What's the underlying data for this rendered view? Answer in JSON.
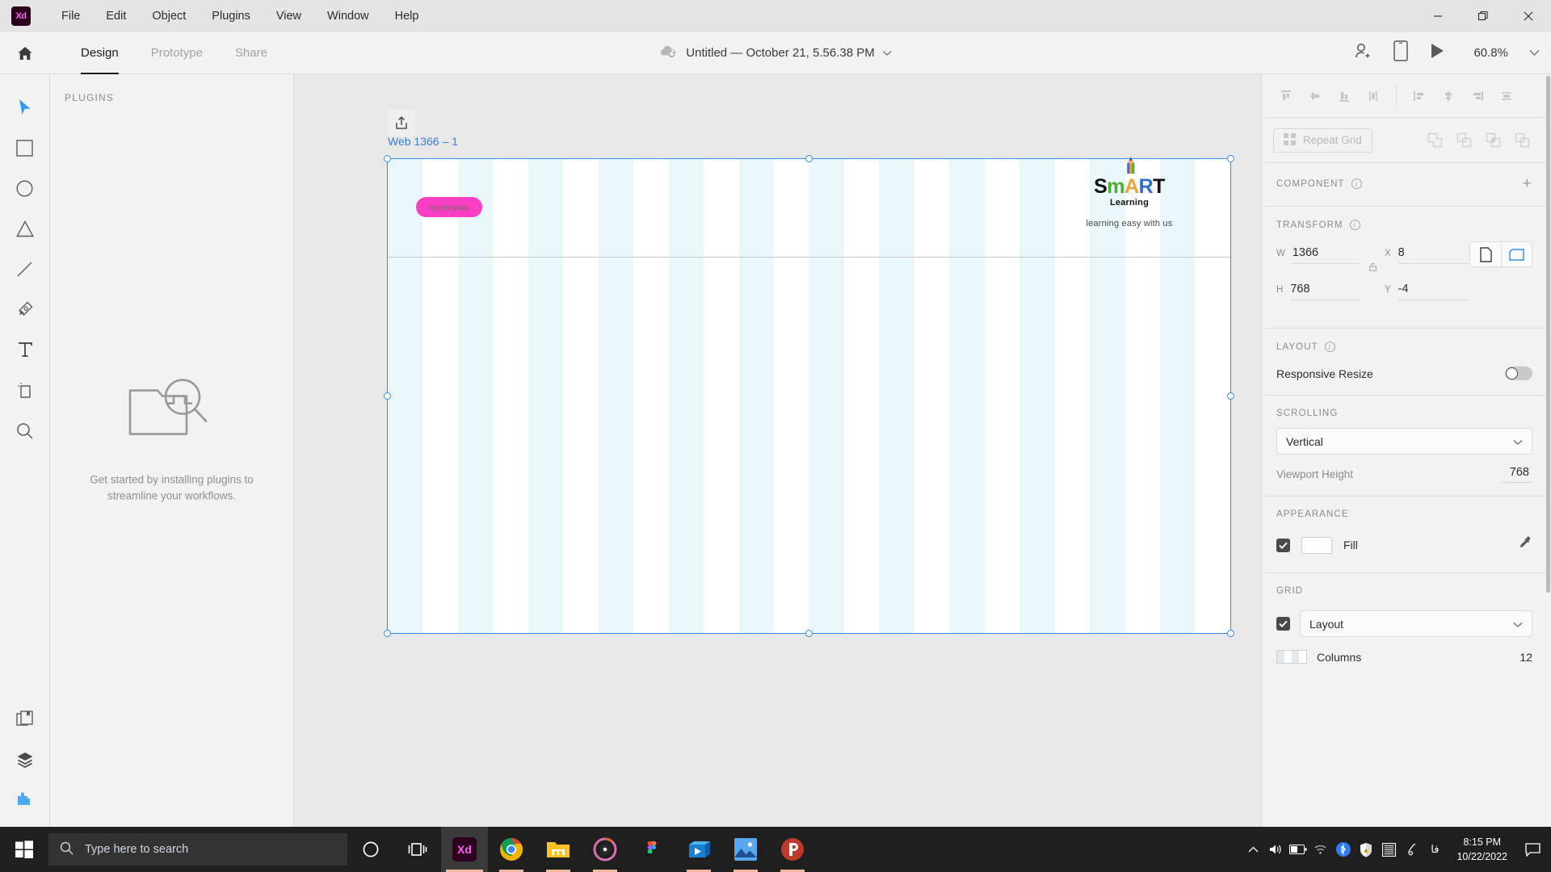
{
  "titlebar": {
    "app_logo": "xd-logo",
    "app_logo_text": "Xd",
    "menus": [
      "File",
      "Edit",
      "Object",
      "Plugins",
      "View",
      "Window",
      "Help"
    ],
    "window_controls": [
      "minimize",
      "maximize",
      "close"
    ]
  },
  "appbar": {
    "home_icon": "home-icon",
    "tabs": [
      {
        "label": "Design",
        "active": true
      },
      {
        "label": "Prototype",
        "active": false
      },
      {
        "label": "Share",
        "active": false
      }
    ],
    "cloud_icon": "cloud-sync-icon",
    "doc_title": "Untitled — October 21, 5.56.38 PM",
    "doc_title_caret": "chevron-down-icon",
    "invite_icon": "invite-user-icon",
    "device_preview_icon": "mobile-device-icon",
    "play_icon": "play-desktop-preview-icon",
    "zoom_level": "60.8%",
    "zoom_caret": "chevron-down-icon"
  },
  "toolbar": {
    "tools": [
      {
        "name": "select-tool",
        "active": true
      },
      {
        "name": "rectangle-tool",
        "active": false
      },
      {
        "name": "ellipse-tool",
        "active": false
      },
      {
        "name": "polygon-tool",
        "active": false
      },
      {
        "name": "line-tool",
        "active": false
      },
      {
        "name": "pen-tool",
        "active": false
      },
      {
        "name": "text-tool",
        "active": false
      },
      {
        "name": "artboard-tool",
        "active": false
      },
      {
        "name": "zoom-tool",
        "active": false
      }
    ],
    "panels": [
      {
        "name": "assets-panel-button",
        "active": false
      },
      {
        "name": "layers-panel-button",
        "active": false
      },
      {
        "name": "plugins-panel-button",
        "active": true
      }
    ]
  },
  "plugins_panel": {
    "title": "PLUGINS",
    "empty_icon": "plugins-search-illustration",
    "empty_text": "Get started by installing plugins to streamline your workflows."
  },
  "canvas": {
    "artboard_export_icon": "export-artboard-icon",
    "artboard_name": "Web 1366 – 1",
    "selected": true,
    "artboard_fill": "#ffffff",
    "grid_color": "#e1f3f8",
    "grid_columns": 12,
    "content": {
      "login_button": "login/registar",
      "login_button_color": "#fb3ec4",
      "brand": {
        "letters": [
          {
            "ch": "S",
            "color": "#111111"
          },
          {
            "ch": "m",
            "color": "#4caf2f"
          },
          {
            "ch": "A",
            "color": "#e8a33d"
          },
          {
            "ch": "R",
            "color": "#2f6fd0"
          },
          {
            "ch": "T",
            "color": "#111111"
          }
        ],
        "wordmark": "SmART",
        "subtitle": "Learning",
        "tagline": "learning easy with us",
        "pencil_icon": "pencil-logo-icon"
      }
    }
  },
  "properties": {
    "align_buttons": [
      "align-top-icon",
      "align-vertical-center-icon",
      "align-bottom-icon",
      "distribute-vertical-icon",
      "align-left-icon",
      "align-horizontal-center-icon",
      "align-right-icon",
      "distribute-horizontal-icon"
    ],
    "repeat_grid_label": "Repeat Grid",
    "repeat_grid_icon": "repeat-grid-icon",
    "boolean_buttons": [
      "add-shape-icon",
      "subtract-shape-icon",
      "intersect-shape-icon",
      "exclude-overlap-icon"
    ],
    "component": {
      "title": "COMPONENT",
      "info_icon": "info-icon",
      "add_icon": "plus-icon"
    },
    "transform": {
      "title": "TRANSFORM",
      "info_icon": "info-icon",
      "w_label": "W",
      "w_value": "1366",
      "x_label": "X",
      "x_value": "8",
      "h_label": "H",
      "h_value": "768",
      "y_label": "Y",
      "y_value": "-4",
      "lock_icon": "unlock-aspect-ratio-icon",
      "orientation_portrait_icon": "portrait-orientation-icon",
      "orientation_landscape_icon": "landscape-orientation-icon",
      "orientation_selected": "landscape"
    },
    "layout": {
      "title": "LAYOUT",
      "info_icon": "info-icon",
      "responsive_resize_label": "Responsive Resize",
      "responsive_resize_on": false
    },
    "scrolling": {
      "title": "SCROLLING",
      "value": "Vertical",
      "caret": "chevron-down-icon",
      "viewport_label": "Viewport Height",
      "viewport_value": "768"
    },
    "appearance": {
      "title": "APPEARANCE",
      "fill_checked": true,
      "fill_label": "Fill",
      "fill_color": "#ffffff",
      "eyedropper_icon": "eyedropper-icon"
    },
    "grid": {
      "title": "GRID",
      "checked": true,
      "type": "Layout",
      "caret": "chevron-down-icon",
      "columns_label": "Columns",
      "columns_value": "12"
    }
  },
  "taskbar": {
    "start_icon": "windows-start-icon",
    "search_icon": "search-icon",
    "search_placeholder": "Type here to search",
    "cortana_icon": "cortana-icon",
    "task_view_icon": "task-view-icon",
    "apps": [
      {
        "name": "adobe-xd-taskbar-icon",
        "label": "Xd",
        "active": true,
        "open": true
      },
      {
        "name": "chrome-taskbar-icon",
        "label": "",
        "active": false,
        "open": true
      },
      {
        "name": "file-explorer-taskbar-icon",
        "label": "",
        "active": false,
        "open": true
      },
      {
        "name": "media-player-taskbar-icon",
        "label": "",
        "active": false,
        "open": true
      },
      {
        "name": "figma-taskbar-icon",
        "label": "",
        "active": false,
        "open": false
      },
      {
        "name": "movies-tv-taskbar-icon",
        "label": "",
        "active": false,
        "open": true
      },
      {
        "name": "photos-taskbar-icon",
        "label": "",
        "active": false,
        "open": true
      },
      {
        "name": "p-app-taskbar-icon",
        "label": "",
        "active": false,
        "open": true
      }
    ],
    "tray": [
      "show-hidden-icons-chevron",
      "volume-icon",
      "battery-icon",
      "wifi-icon",
      "bluetooth-icon",
      "security-shield-icon",
      "unknown-tray-icon",
      "pen-tray-icon"
    ],
    "ime_label": "فا",
    "time": "8:15 PM",
    "date": "10/22/2022",
    "notification_icon": "notification-center-icon"
  }
}
